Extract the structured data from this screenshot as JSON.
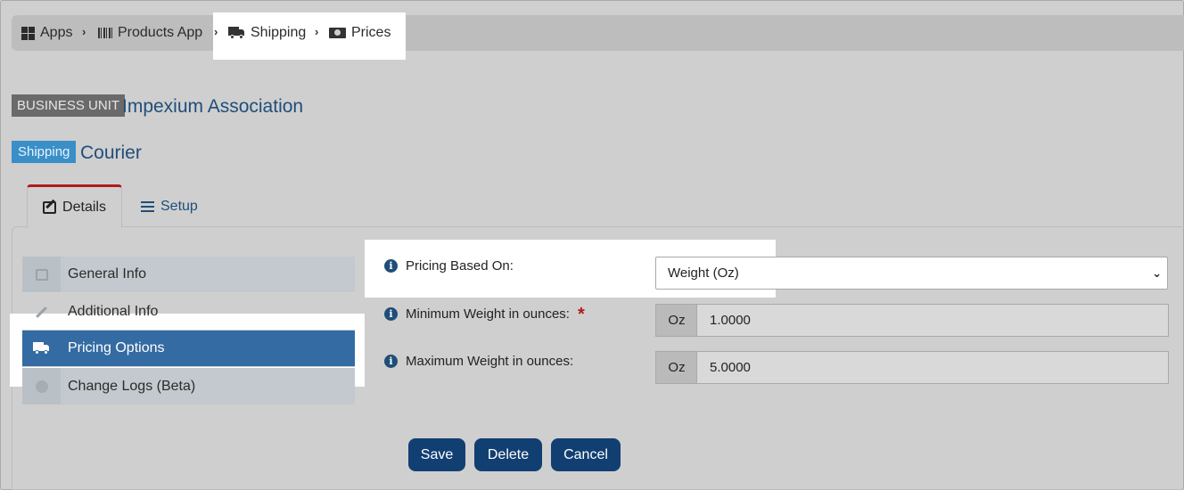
{
  "breadcrumb": {
    "items": [
      {
        "label": "Apps",
        "icon": "apps-grid-icon"
      },
      {
        "label": "Products App",
        "icon": "barcode-icon"
      },
      {
        "label": "Shipping",
        "icon": "truck-icon"
      },
      {
        "label": "Prices",
        "icon": "money-icon"
      }
    ]
  },
  "header": {
    "business_unit_badge": "BUSINESS UNIT",
    "business_unit_name": "Impexium Association",
    "shipping_badge": "Shipping",
    "shipping_name": "Courier"
  },
  "tabs": [
    {
      "label": "Details",
      "icon": "edit-icon",
      "active": true
    },
    {
      "label": "Setup",
      "icon": "list-icon",
      "active": false
    }
  ],
  "nav": {
    "items": [
      {
        "label": "General Info",
        "icon": "edit-icon"
      },
      {
        "label": "Additional Info",
        "icon": "pencil-icon"
      },
      {
        "label": "Pricing Options",
        "icon": "truck-icon",
        "active": true
      },
      {
        "label": "Change Logs (Beta)",
        "icon": "circle-icon"
      }
    ]
  },
  "form": {
    "pricing_based_on_label": "Pricing Based On:",
    "pricing_based_on_value": "Weight (Oz)",
    "min_weight_label": "Minimum Weight in ounces:",
    "min_weight_required": "*",
    "min_weight_unit": "Oz",
    "min_weight_value": "1.0000",
    "max_weight_label": "Maximum Weight in ounces:",
    "max_weight_unit": "Oz",
    "max_weight_value": "5.0000"
  },
  "buttons": {
    "save": "Save",
    "delete": "Delete",
    "cancel": "Cancel"
  },
  "colors": {
    "primary_button": "#123f72",
    "active_nav": "#346ba2",
    "shipping_badge": "#3a8fc9",
    "required": "#b11b1b"
  }
}
